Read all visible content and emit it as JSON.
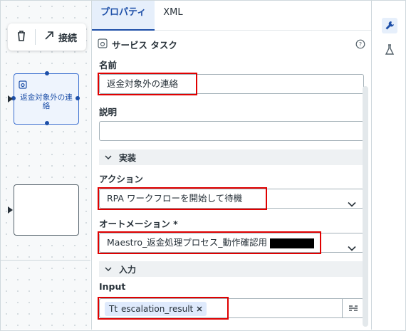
{
  "canvas": {
    "toolbar": {
      "connect_label": "接続"
    },
    "nodes": [
      {
        "label": "返金対象外の連絡"
      },
      {
        "label": ""
      }
    ]
  },
  "panel": {
    "tabs": [
      {
        "label": "プロパティ",
        "active": true
      },
      {
        "label": "XML",
        "active": false
      }
    ],
    "header_title": "サービス タスク",
    "fields": {
      "name": {
        "label": "名前",
        "value": "返金対象外の連絡"
      },
      "description": {
        "label": "説明",
        "value": ""
      },
      "implementation_section": "実装",
      "action": {
        "label": "アクション",
        "value": "RPA ワークフローを開始して待機"
      },
      "automation": {
        "label": "オートメーション *",
        "value": "Maestro_返金処理プロセス_動作確認用"
      },
      "input_section": "入力",
      "input": {
        "label": "Input",
        "chip_prefix": "Tt",
        "chip_value": "escalation_result"
      }
    }
  },
  "colors": {
    "accent": "#1d4fa8",
    "highlight": "#e00000",
    "section_bg": "#eef1f3"
  },
  "icons": [
    "trash-icon",
    "arrow-connect-icon",
    "service-task-icon",
    "help-icon",
    "chevron-down-icon",
    "close-icon",
    "variable-picker-icon",
    "wrench-icon",
    "flask-icon"
  ]
}
